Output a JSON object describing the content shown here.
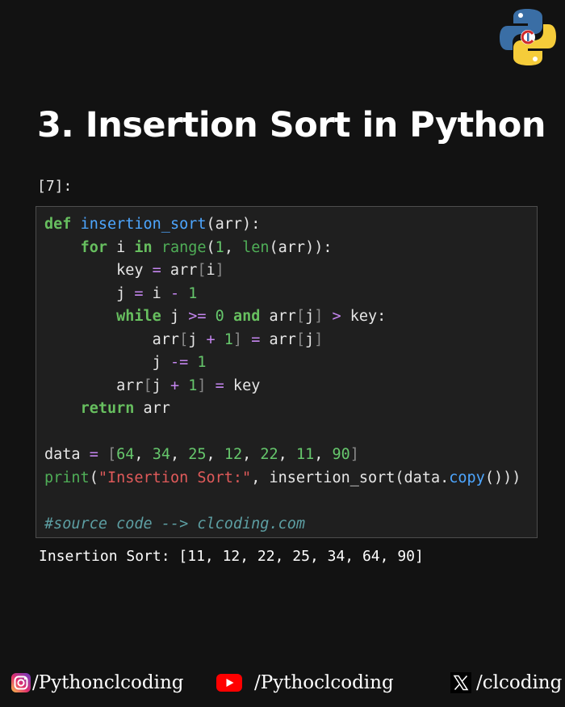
{
  "title": "3. Insertion Sort in Python",
  "cell_prompt": "[7]:",
  "code_lines": [
    [
      {
        "t": "def",
        "c": "keyword-bold"
      },
      {
        "t": " ",
        "c": "text"
      },
      {
        "t": "insertion_sort",
        "c": "func"
      },
      {
        "t": "(arr):",
        "c": "text"
      }
    ],
    [
      {
        "t": "    ",
        "c": "text"
      },
      {
        "t": "for",
        "c": "keyword-bold"
      },
      {
        "t": " i ",
        "c": "text"
      },
      {
        "t": "in",
        "c": "keyword-bold"
      },
      {
        "t": " ",
        "c": "text"
      },
      {
        "t": "range",
        "c": "builtin"
      },
      {
        "t": "(",
        "c": "text"
      },
      {
        "t": "1",
        "c": "number"
      },
      {
        "t": ", ",
        "c": "text"
      },
      {
        "t": "len",
        "c": "builtin"
      },
      {
        "t": "(arr)):",
        "c": "text"
      }
    ],
    [
      {
        "t": "        key ",
        "c": "text"
      },
      {
        "t": "=",
        "c": "operator"
      },
      {
        "t": " arr",
        "c": "text"
      },
      {
        "t": "[",
        "c": "bracket"
      },
      {
        "t": "i",
        "c": "text"
      },
      {
        "t": "]",
        "c": "bracket"
      }
    ],
    [
      {
        "t": "        j ",
        "c": "text"
      },
      {
        "t": "=",
        "c": "operator"
      },
      {
        "t": " i ",
        "c": "text"
      },
      {
        "t": "-",
        "c": "operator"
      },
      {
        "t": " ",
        "c": "text"
      },
      {
        "t": "1",
        "c": "number"
      }
    ],
    [
      {
        "t": "        ",
        "c": "text"
      },
      {
        "t": "while",
        "c": "keyword-bold"
      },
      {
        "t": " j ",
        "c": "text"
      },
      {
        "t": ">=",
        "c": "operator"
      },
      {
        "t": " ",
        "c": "text"
      },
      {
        "t": "0",
        "c": "number"
      },
      {
        "t": " ",
        "c": "text"
      },
      {
        "t": "and",
        "c": "keyword-bold"
      },
      {
        "t": " arr",
        "c": "text"
      },
      {
        "t": "[",
        "c": "bracket"
      },
      {
        "t": "j",
        "c": "text"
      },
      {
        "t": "]",
        "c": "bracket"
      },
      {
        "t": " ",
        "c": "text"
      },
      {
        "t": ">",
        "c": "operator"
      },
      {
        "t": " key:",
        "c": "text"
      }
    ],
    [
      {
        "t": "            arr",
        "c": "text"
      },
      {
        "t": "[",
        "c": "bracket"
      },
      {
        "t": "j ",
        "c": "text"
      },
      {
        "t": "+",
        "c": "operator"
      },
      {
        "t": " ",
        "c": "text"
      },
      {
        "t": "1",
        "c": "number"
      },
      {
        "t": "]",
        "c": "bracket"
      },
      {
        "t": " ",
        "c": "text"
      },
      {
        "t": "=",
        "c": "operator"
      },
      {
        "t": " arr",
        "c": "text"
      },
      {
        "t": "[",
        "c": "bracket"
      },
      {
        "t": "j",
        "c": "text"
      },
      {
        "t": "]",
        "c": "bracket"
      }
    ],
    [
      {
        "t": "            j ",
        "c": "text"
      },
      {
        "t": "-=",
        "c": "operator"
      },
      {
        "t": " ",
        "c": "text"
      },
      {
        "t": "1",
        "c": "number"
      }
    ],
    [
      {
        "t": "        arr",
        "c": "text"
      },
      {
        "t": "[",
        "c": "bracket"
      },
      {
        "t": "j ",
        "c": "text"
      },
      {
        "t": "+",
        "c": "operator"
      },
      {
        "t": " ",
        "c": "text"
      },
      {
        "t": "1",
        "c": "number"
      },
      {
        "t": "]",
        "c": "bracket"
      },
      {
        "t": " ",
        "c": "text"
      },
      {
        "t": "=",
        "c": "operator"
      },
      {
        "t": " key",
        "c": "text"
      }
    ],
    [
      {
        "t": "    ",
        "c": "text"
      },
      {
        "t": "return",
        "c": "keyword-bold"
      },
      {
        "t": " arr",
        "c": "text"
      }
    ],
    [],
    [
      {
        "t": "data ",
        "c": "text"
      },
      {
        "t": "=",
        "c": "operator"
      },
      {
        "t": " ",
        "c": "text"
      },
      {
        "t": "[",
        "c": "bracket"
      },
      {
        "t": "64",
        "c": "number"
      },
      {
        "t": ", ",
        "c": "text"
      },
      {
        "t": "34",
        "c": "number"
      },
      {
        "t": ", ",
        "c": "text"
      },
      {
        "t": "25",
        "c": "number"
      },
      {
        "t": ", ",
        "c": "text"
      },
      {
        "t": "12",
        "c": "number"
      },
      {
        "t": ", ",
        "c": "text"
      },
      {
        "t": "22",
        "c": "number"
      },
      {
        "t": ", ",
        "c": "text"
      },
      {
        "t": "11",
        "c": "number"
      },
      {
        "t": ", ",
        "c": "text"
      },
      {
        "t": "90",
        "c": "number"
      },
      {
        "t": "]",
        "c": "bracket"
      }
    ],
    [
      {
        "t": "print",
        "c": "builtin"
      },
      {
        "t": "(",
        "c": "text"
      },
      {
        "t": "\"Insertion Sort:\"",
        "c": "string"
      },
      {
        "t": ", insertion_sort(data.",
        "c": "text"
      },
      {
        "t": "copy",
        "c": "func"
      },
      {
        "t": "()))",
        "c": "text"
      }
    ],
    [],
    [
      {
        "t": "#source code --> clcoding.com",
        "c": "comment"
      }
    ]
  ],
  "output_text": "Insertion Sort: [11, 12, 22, 25, 34, 64, 90]",
  "footer": {
    "instagram_handle": "/Pythonclcoding",
    "youtube_handle": "/Pythoclcoding",
    "x_handle": "/clcoding"
  },
  "icons": {
    "logo": "python-clcoding-logo-icon",
    "instagram": "instagram-icon",
    "youtube": "youtube-icon",
    "x": "x-icon"
  },
  "colors": {
    "background": "#121212",
    "code_background": "#1f1f1f",
    "keyword": "#67bf5f",
    "function": "#4da6ff",
    "operator": "#c586f0",
    "string": "#e05a5a",
    "comment": "#5d9fa3",
    "python_blue": "#3a6ea5",
    "python_yellow": "#f5cc3a",
    "youtube_red": "#ff0000"
  }
}
